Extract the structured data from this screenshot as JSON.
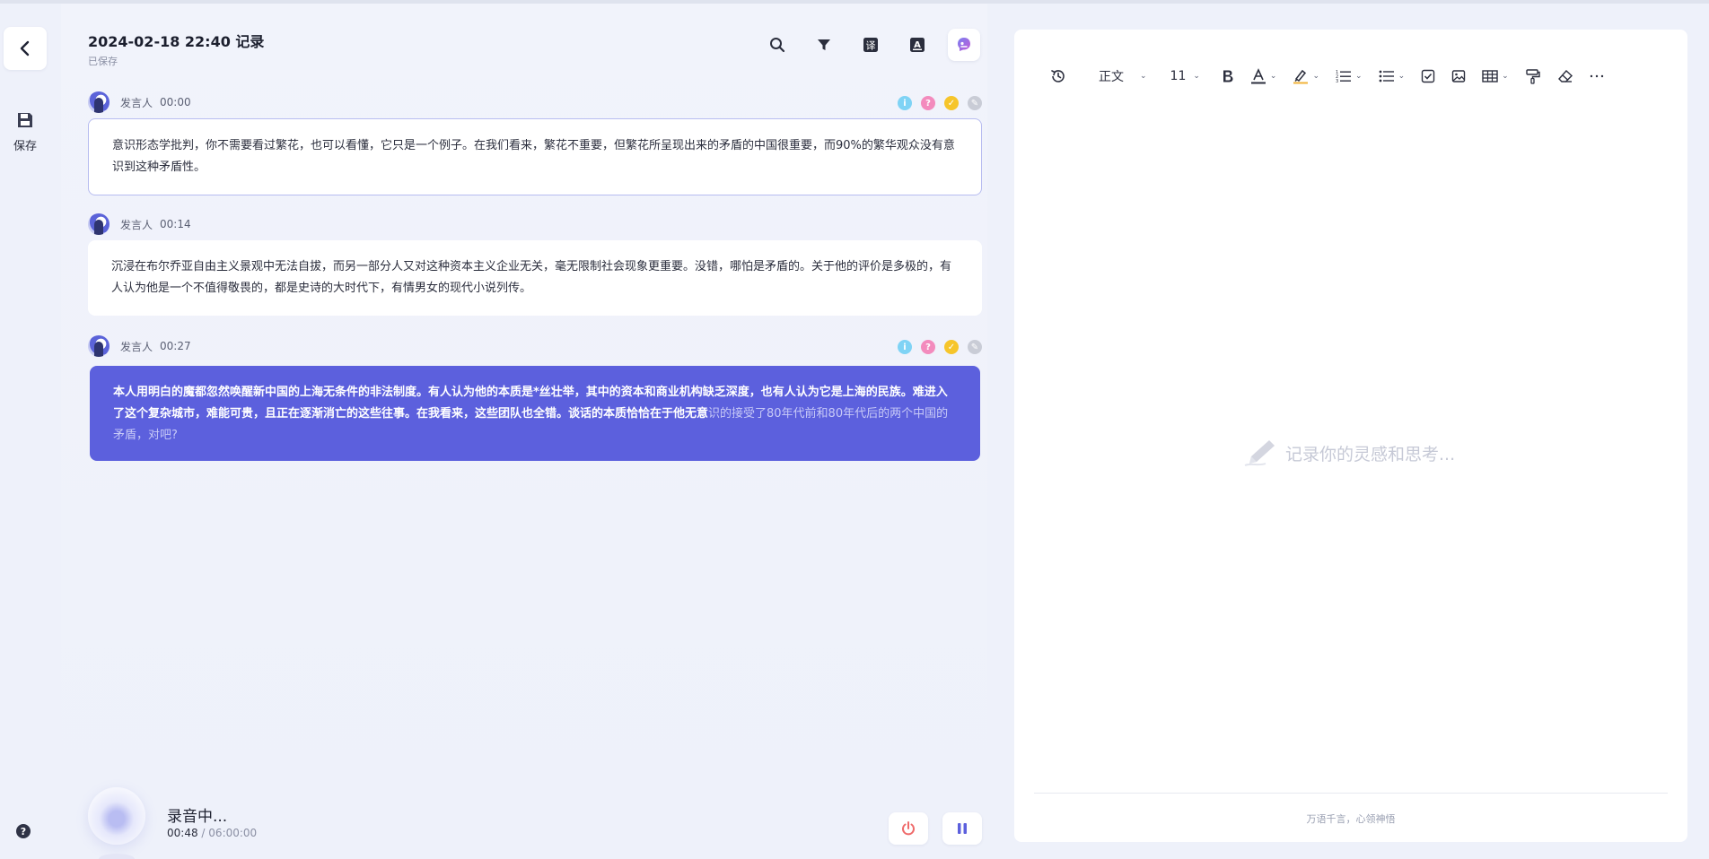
{
  "app": {
    "accent": "#5c60dd",
    "rail": {
      "save_label": "保存"
    },
    "header": {
      "title": "2024-02-18 22:40 记录",
      "status": "已保存"
    },
    "toolbar_icons": [
      "search-icon",
      "filter-icon",
      "translate-icon",
      "font-icon",
      "ai-assistant-icon"
    ],
    "segments": [
      {
        "speaker": "发言人",
        "time": "00:00",
        "text": "意识形态学批判，你不需要看过繁花，也可以看懂，它只是一个例子。在我们看来，繁花不重要，但繁花所呈现出来的矛盾的中国很重要，而90%的繁华观众没有意识到这种矛盾性。"
      },
      {
        "speaker": "发言人",
        "time": "00:14",
        "text": "沉浸在布尔乔亚自由主义景观中无法自拔，而另一部分人又对这种资本主义企业无关，毫无限制社会现象更重要。没错，哪怕是矛盾的。关于他的评价是多极的，有人认为他是一个不值得敬畏的，都是史诗的大时代下，有情男女的现代小说列传。"
      },
      {
        "speaker": "发言人",
        "time": "00:27",
        "text": "本人用明白的魔都忽然唤醒新中国的上海无条件的非法制度。有人认为他的本质是*丝壮举，其中的资本和商业机构缺乏深度，也有人认为它是上海的民族。难进入了这个复杂城市，难能可贵，且正在逐渐消亡的这些往事。在我看来，这些团队也全错。谈话的本质恰恰在于他无意",
        "pending_text": "识的接受了80年代前和80年代后的两个中国的矛盾，对吧?"
      }
    ],
    "recording": {
      "status": "录音中...",
      "elapsed": "00:48",
      "separator": "/",
      "total": "06:00:00"
    },
    "editor": {
      "style_value": "正文",
      "size_value": "11",
      "placeholder": "记录你的灵感和思考...",
      "footer": "万语千言，心领神悟"
    }
  }
}
